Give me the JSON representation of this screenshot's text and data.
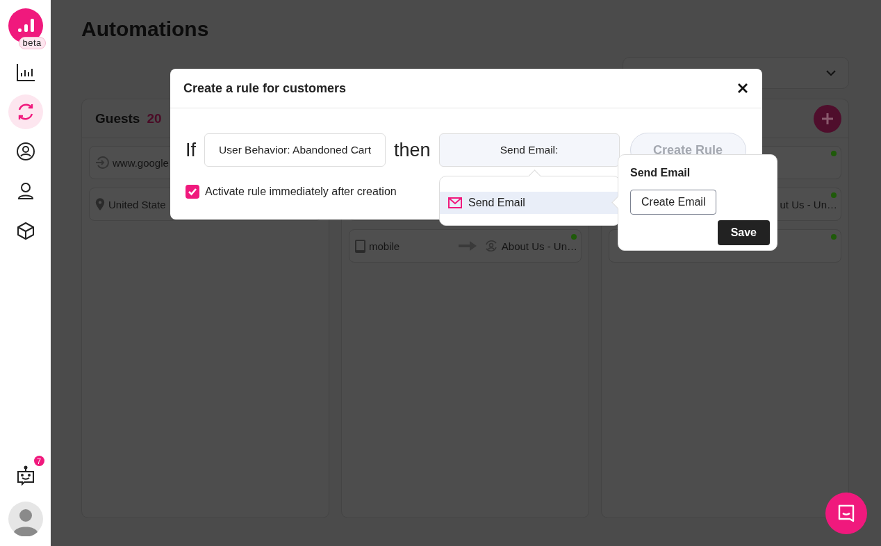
{
  "sidebar": {
    "logo_badge": "beta",
    "nav": [
      {
        "selected": false
      },
      {
        "selected": true
      },
      {
        "selected": false
      },
      {
        "selected": false
      },
      {
        "selected": false
      }
    ],
    "bot_badge": "7"
  },
  "page": {
    "title": "Automations"
  },
  "columns": [
    {
      "title": "Guests",
      "count": "20",
      "cards": [
        {
          "kind": "referrer",
          "text": "www.google"
        },
        {
          "kind": "location",
          "text": "United State"
        }
      ]
    },
    {
      "cards": [
        {
          "kind": "blank"
        },
        {
          "kind": "device",
          "text": "mobile",
          "target": "About Us - Un…",
          "online": true
        }
      ]
    },
    {
      "add_button": true,
      "cards": [
        {
          "kind": "blank",
          "online": true
        },
        {
          "kind": "page",
          "target": "ut Us - Un…",
          "online": true
        },
        {
          "kind": "blank",
          "online": true
        }
      ]
    }
  ],
  "modal": {
    "title": "Create a rule for customers",
    "if_label": "If",
    "condition": "User Behavior: Abandoned Cart",
    "then_label": "then",
    "action": "Send Email:",
    "create_button": {
      "label": "Create Rule",
      "disabled": true
    },
    "activate": {
      "label": "Activate rule immediately after creation",
      "checked": true
    }
  },
  "action_menu": {
    "items": [
      {
        "label": "Send Email",
        "selected": true
      }
    ]
  },
  "popover": {
    "title": "Send Email",
    "create_button": "Create Email",
    "save_button": "Save"
  }
}
